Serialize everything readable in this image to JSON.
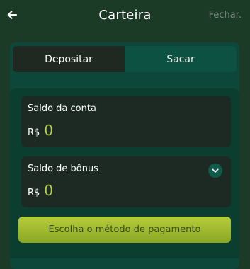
{
  "header": {
    "title": "Carteira",
    "close_label": "Fechar."
  },
  "tabs": [
    {
      "label": "Depositar",
      "active": true
    },
    {
      "label": "Sacar",
      "active": false
    }
  ],
  "balances": {
    "account": {
      "label": "Saldo da conta",
      "currency": "R$",
      "value": "0"
    },
    "bonus": {
      "label": "Saldo de bônus",
      "currency": "R$",
      "value": "0"
    }
  },
  "payment_button": {
    "label": "Escolha o método de pagamento"
  },
  "colors": {
    "background": "#1b3b27",
    "panel": "#0c4739",
    "card": "#1d2a24",
    "accent": "#b4d04b",
    "button": "#a7c232"
  },
  "icons": {
    "back": "arrow-left-icon",
    "expand": "chevron-down-icon"
  }
}
